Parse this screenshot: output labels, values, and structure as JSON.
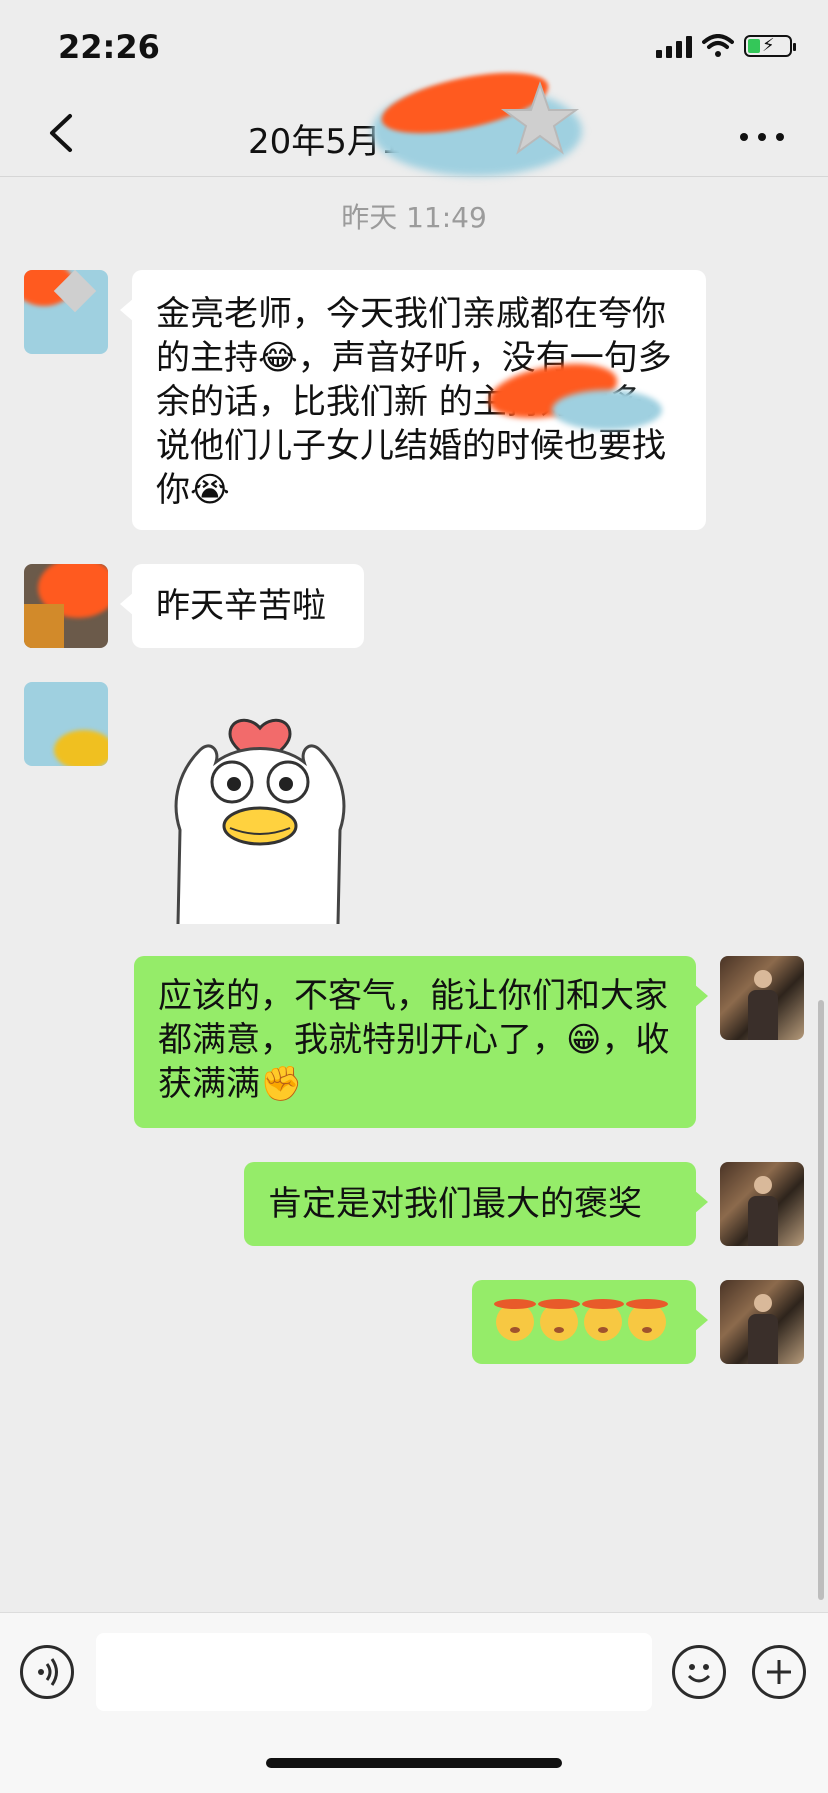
{
  "status_bar": {
    "time": "22:26"
  },
  "nav": {
    "title": "20年5月1",
    "back_icon": "chevron-left-icon",
    "more_icon": "more-dots-icon"
  },
  "chat": {
    "timestamp": "昨天 11:49",
    "messages": [
      {
        "side": "in",
        "type": "text",
        "text": "金亮老师，今天我们亲戚都在夸你的主持😂，声音好听，没有一句多余的话，比我们新  的主持好太多，说他们儿子女儿结婚的时候也要找你😭"
      },
      {
        "side": "in",
        "type": "text",
        "text": "昨天辛苦啦"
      },
      {
        "side": "in",
        "type": "sticker",
        "sticker": "duck-heart-sticker"
      },
      {
        "side": "out",
        "type": "text",
        "text": "应该的，不客气，能让你们和大家都满意，我就特别开心了，😁，收获满满✊"
      },
      {
        "side": "out",
        "type": "text",
        "text": "肯定是对我们最大的褒奖"
      },
      {
        "side": "out",
        "type": "emoji",
        "emoji_count": 4,
        "emoji": "shushing-face-emoji"
      }
    ]
  },
  "colors": {
    "background": "#ededed",
    "incoming_bubble": "#ffffff",
    "outgoing_bubble": "#95ec69"
  },
  "input_bar": {
    "voice_icon": "voice-icon",
    "emoji_icon": "emoji-icon",
    "plus_icon": "plus-icon"
  }
}
